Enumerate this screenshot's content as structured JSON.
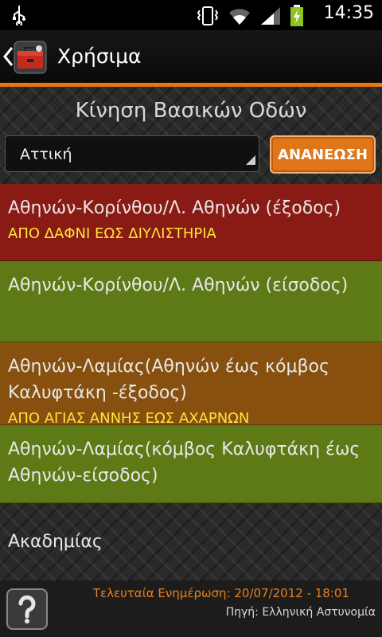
{
  "status_bar": {
    "time": "14:35",
    "icons": [
      "usb-icon",
      "vibrate-icon",
      "wifi-icon",
      "signal-icon",
      "battery-charging-icon"
    ]
  },
  "header": {
    "title": "Χρήσιμα",
    "accent_color": "#e87511"
  },
  "main": {
    "section_title": "Κίνηση Βασικών Οδών",
    "region_select": {
      "value": "Αττική"
    },
    "refresh_button": "ΑΝΑΝΕΩΣΗ"
  },
  "roads": [
    {
      "name": "Αθηνών-Κορίνθου/Λ. Αθηνών (έξοδος)",
      "status": "ΑΠΟ ΔΑΦΝΙ ΕΩΣ ΔΙΥΛΙΣΤΗΡΙΑ",
      "color": "red"
    },
    {
      "name": "Αθηνών-Κορίνθου/Λ. Αθηνών (είσοδος)",
      "status": "",
      "color": "green"
    },
    {
      "name": "Αθηνών-Λαμίας(Αθηνών έως κόμβος Καλυφτάκη -έξοδος)",
      "status": "ΑΠΟ ΑΓΙΑΣ ΑΝΝΗΣ ΕΩΣ ΑΧΑΡΝΩΝ",
      "color": "orange"
    },
    {
      "name": "Αθηνών-Λαμίας(κόμβος Καλυφτάκη έως Αθηνών-είσοδος)",
      "status": "",
      "color": "green"
    },
    {
      "name": "Ακαδημίας",
      "status": "",
      "color": "plain"
    }
  ],
  "footer": {
    "last_update": "Τελευταία Ενημέρωση: 20/07/2012 - 18:01",
    "source": "Πηγή: Ελληνική Αστυνομία"
  }
}
